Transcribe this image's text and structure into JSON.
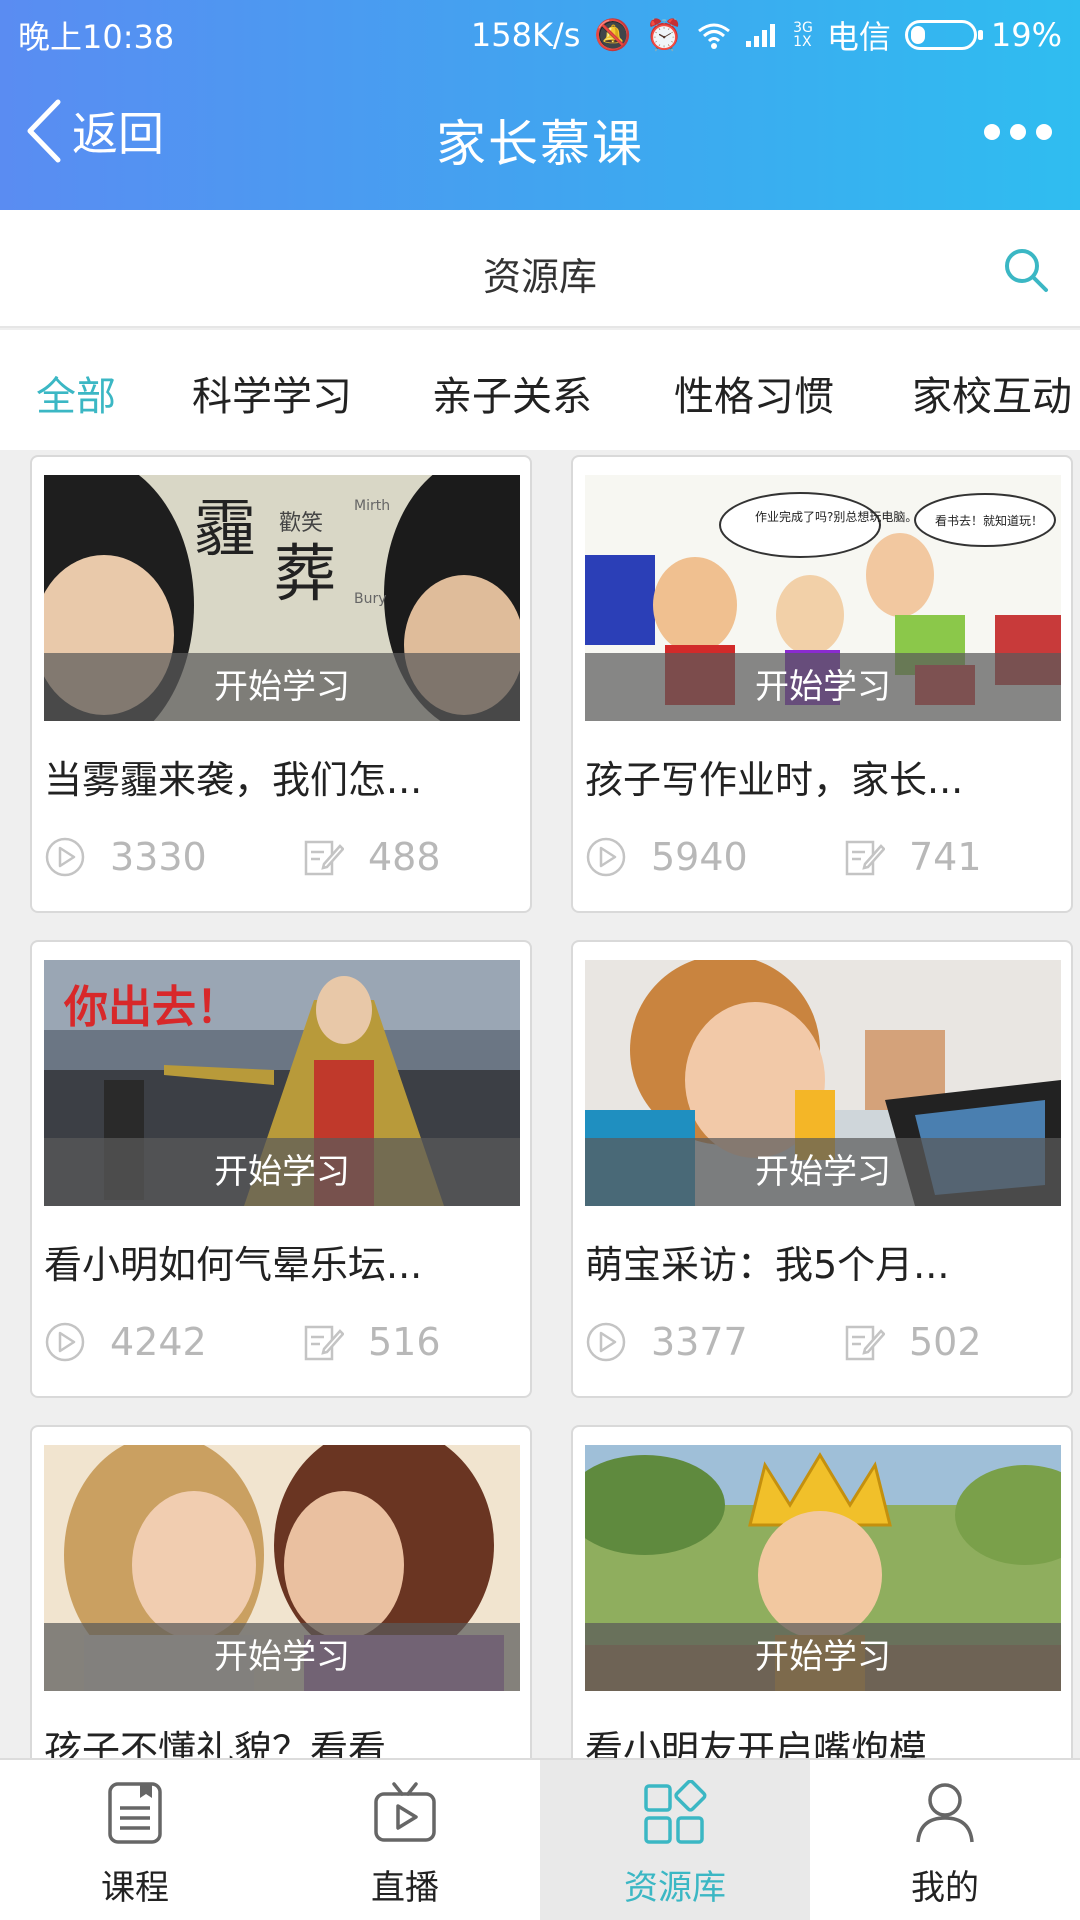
{
  "status_bar": {
    "time": "晚上10:38",
    "speed": "158K/s",
    "network_type_top": "3G",
    "network_type_bottom": "1X",
    "carrier": "电信",
    "battery": "19%"
  },
  "navbar": {
    "back_label": "返回",
    "title": "家长慕课"
  },
  "subheader": {
    "label": "资源库"
  },
  "tabs": [
    {
      "label": "全部",
      "active": true
    },
    {
      "label": "科学学习",
      "active": false
    },
    {
      "label": "亲子关系",
      "active": false
    },
    {
      "label": "性格习惯",
      "active": false
    },
    {
      "label": "家校互动",
      "active": false
    }
  ],
  "overlay_label": "开始学习",
  "cards": [
    {
      "title": "当雾霾来袭，我们怎...",
      "plays": "3330",
      "notes": "488",
      "image_caption": [
        "霾",
        "歡笑",
        "葬",
        "Mirth",
        "Bury"
      ]
    },
    {
      "title": "孩子写作业时，家长...",
      "plays": "5940",
      "notes": "741",
      "image_caption": [
        "作业完成了吗?别总想玩电脑。",
        "看书去！就知道玩！"
      ]
    },
    {
      "title": "看小明如何气晕乐坛...",
      "plays": "4242",
      "notes": "516",
      "image_caption": [
        "你出去！"
      ]
    },
    {
      "title": "萌宝采访：我5个月...",
      "plays": "3377",
      "notes": "502",
      "image_caption": []
    },
    {
      "title": "孩子不懂礼貌？看看...",
      "plays": "",
      "notes": "",
      "image_caption": []
    },
    {
      "title": "看小明友开启嘴炮模...",
      "plays": "",
      "notes": "",
      "image_caption": []
    }
  ],
  "bottom_nav": [
    {
      "label": "课程",
      "icon": "document-icon",
      "active": false
    },
    {
      "label": "直播",
      "icon": "tv-play-icon",
      "active": false
    },
    {
      "label": "资源库",
      "icon": "grid-diamond-icon",
      "active": true
    },
    {
      "label": "我的",
      "icon": "person-icon",
      "active": false
    }
  ],
  "colors": {
    "accent": "#3bb7c4",
    "header_start": "#5a8cf2",
    "header_end": "#2fbdf0",
    "stat_gray": "#b8b8b8"
  }
}
